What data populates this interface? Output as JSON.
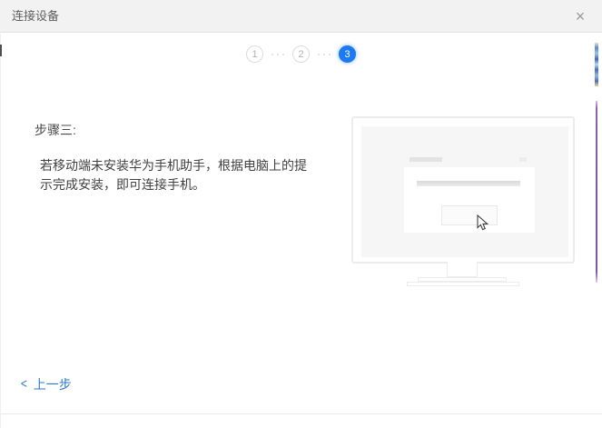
{
  "window": {
    "title": "连接设备",
    "close_glyph": "×"
  },
  "stepper": {
    "steps": [
      {
        "label": "1",
        "active": false
      },
      {
        "label": "2",
        "active": false
      },
      {
        "label": "3",
        "active": true
      }
    ],
    "active_step": 3,
    "active_color": "#1d7af3"
  },
  "content": {
    "step_heading": "步骤三:",
    "instruction": "若移动端未安装华为手机助手，根据电脑上的提示完成安装，即可连接手机。"
  },
  "illustration": {
    "type": "desktop-monitor-with-install-dialog",
    "cursor_icon": "arrow-cursor"
  },
  "footer": {
    "back_chevron": "<",
    "back_label": "上一步"
  },
  "colors": {
    "accent_blue": "#1d7af3",
    "link_blue": "#2879cf",
    "titlebar_bg": "#f2f2f2",
    "inactive_step_border": "#dcdcdc"
  }
}
